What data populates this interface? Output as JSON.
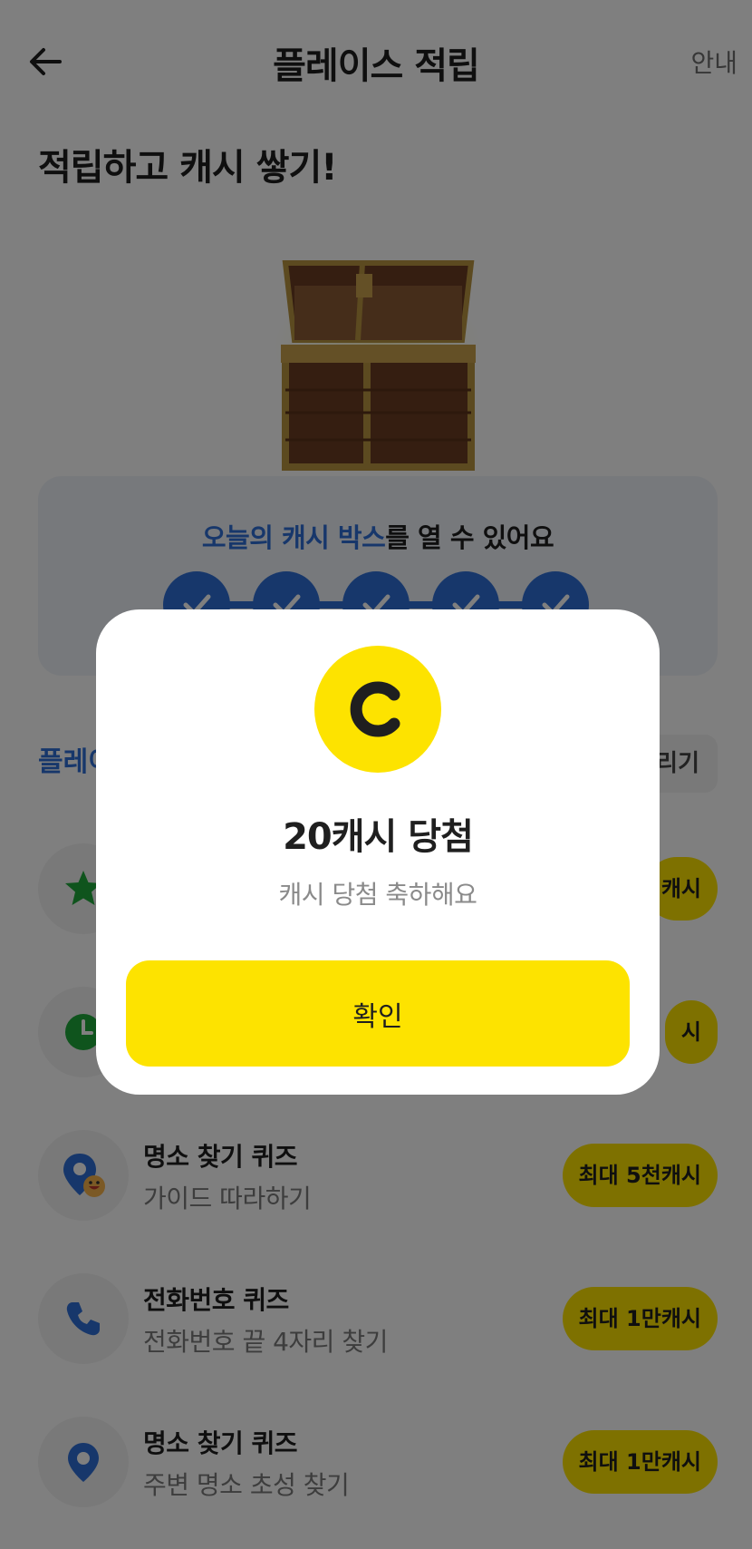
{
  "header": {
    "title": "플레이스 적립",
    "guide_label": "안내"
  },
  "headline": "적립하고 캐시 쌓기!",
  "cash_box": {
    "highlight": "오늘의 캐시 박스",
    "rest": "를 열 수 있어요",
    "completed_steps": 5
  },
  "section": {
    "title": "플레이",
    "button_label": "리기"
  },
  "missions": [
    {
      "title": "",
      "subtitle": "",
      "reward": "캐시",
      "icon": "star-icon"
    },
    {
      "title": "",
      "subtitle": "",
      "reward": "시",
      "icon": "clock-icon"
    },
    {
      "title": "명소 찾기 퀴즈",
      "subtitle": "가이드 따라하기",
      "reward": "최대 5천캐시",
      "icon": "map-pin-smile-icon"
    },
    {
      "title": "전화번호 퀴즈",
      "subtitle": "전화번호 끝 4자리 찾기",
      "reward": "최대 1만캐시",
      "icon": "phone-icon"
    },
    {
      "title": "명소 찾기 퀴즈",
      "subtitle": "주변 명소 초성 찾기",
      "reward": "최대 1만캐시",
      "icon": "map-pin-icon"
    }
  ],
  "modal": {
    "coin_letter": "C",
    "title": "20캐시 당첨",
    "subtitle": "캐시 당첨 축하해요",
    "confirm_label": "확인"
  },
  "colors": {
    "accent_yellow": "#fde300",
    "accent_blue": "#2f6fd6",
    "overlay": "rgba(0,0,0,0.5)"
  }
}
